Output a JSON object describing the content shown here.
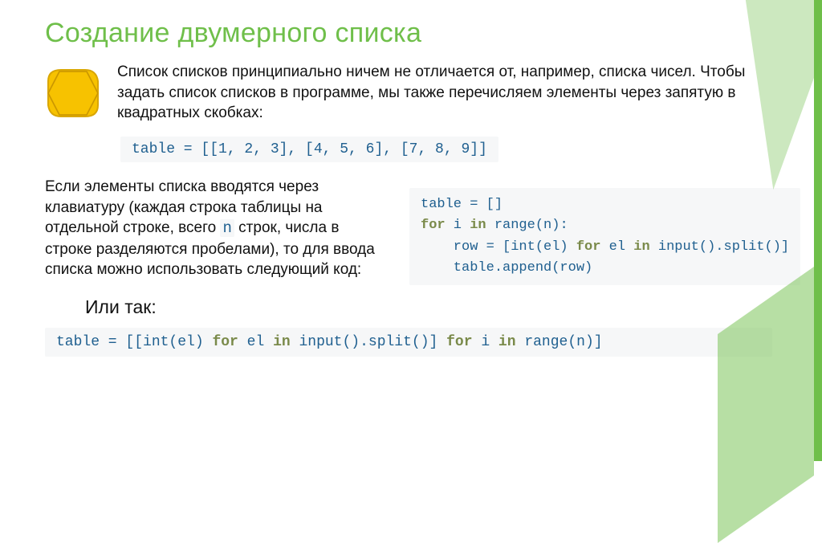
{
  "title": "Создание двумерного списка",
  "paragraph1": "Список списков принципиально ничем не отличается от, например, списка чисел. Чтобы задать список списков в программе, мы также перечисляем элементы через запятую в квадратных скобках:",
  "code1": "table = [[1, 2, 3], [4, 5, 6], [7, 8, 9]]",
  "paragraph2_a": "Если элементы списка вводятся через клавиатуру (каждая строка таблицы на отдельной строке, всего ",
  "paragraph2_n": "n",
  "paragraph2_b": " строк, числа в строке разделяются пробелами), то для ввода списка можно использовать следующий код:",
  "code2": {
    "l1": "table = []",
    "l2a": "for",
    "l2b": " i ",
    "l2c": "in",
    "l2d": " range(n):",
    "l3a": "    row = [int(el) ",
    "l3b": "for",
    "l3c": " el ",
    "l3d": "in",
    "l3e": " input().split()]",
    "l4": "    table.append(row)"
  },
  "alt_label": "Или так:",
  "code3": {
    "a": "table = [[int(el) ",
    "b": "for",
    "c": " el ",
    "d": "in",
    "e": " input().split()] ",
    "f": "for",
    "g": " i ",
    "h": "in",
    "i": " range(n)]"
  }
}
